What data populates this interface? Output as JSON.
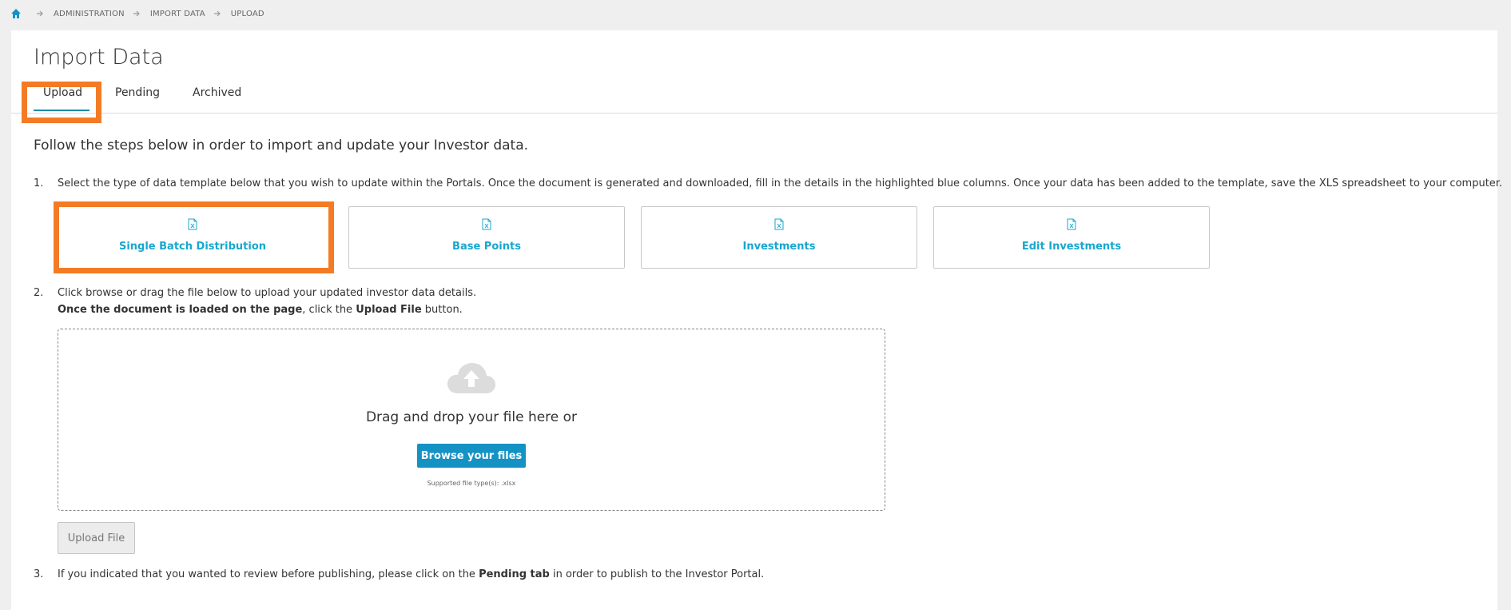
{
  "breadcrumb": {
    "items": [
      "ADMINISTRATION",
      "IMPORT DATA",
      "UPLOAD"
    ]
  },
  "page": {
    "title": "Import Data"
  },
  "tabs": [
    {
      "label": "Upload",
      "active": true
    },
    {
      "label": "Pending",
      "active": false
    },
    {
      "label": "Archived",
      "active": false
    }
  ],
  "intro": "Follow the steps below in order to import and update your Investor data.",
  "step1": {
    "number": "1.",
    "text": "Select the type of data template below that you wish to update within the Portals. Once the document is generated and downloaded, fill in the details in the highlighted blue columns. Once your data has been added to the template, save the XLS spreadsheet to your computer."
  },
  "templates": [
    {
      "label": "Single Batch Distribution",
      "icon": "excel-file-icon"
    },
    {
      "label": "Base Points",
      "icon": "excel-file-icon"
    },
    {
      "label": "Investments",
      "icon": "excel-file-icon"
    },
    {
      "label": "Edit Investments",
      "icon": "excel-file-icon"
    }
  ],
  "step2": {
    "number": "2.",
    "line1": "Click browse or drag the file below to upload your updated investor data details.",
    "line2_bold": "Once the document is loaded on the page",
    "line2_mid": ", click the ",
    "line2_bold2": "Upload File",
    "line2_end": " button."
  },
  "dropzone": {
    "icon": "cloud-upload-icon",
    "text": "Drag and drop your file here or",
    "browse_label": "Browse your files",
    "supported": "Supported file type(s): .xlsx"
  },
  "upload_button": "Upload File",
  "step3": {
    "number": "3.",
    "pre": "If you indicated that you wanted to review before publishing, please click on the ",
    "bold": "Pending tab",
    "post": " in order to publish to the Investor Portal."
  },
  "colors": {
    "accent": "#18a7cf",
    "primary_button": "#1592c4",
    "highlight": "#f47b25",
    "tab_underline": "#1a8ea8"
  }
}
